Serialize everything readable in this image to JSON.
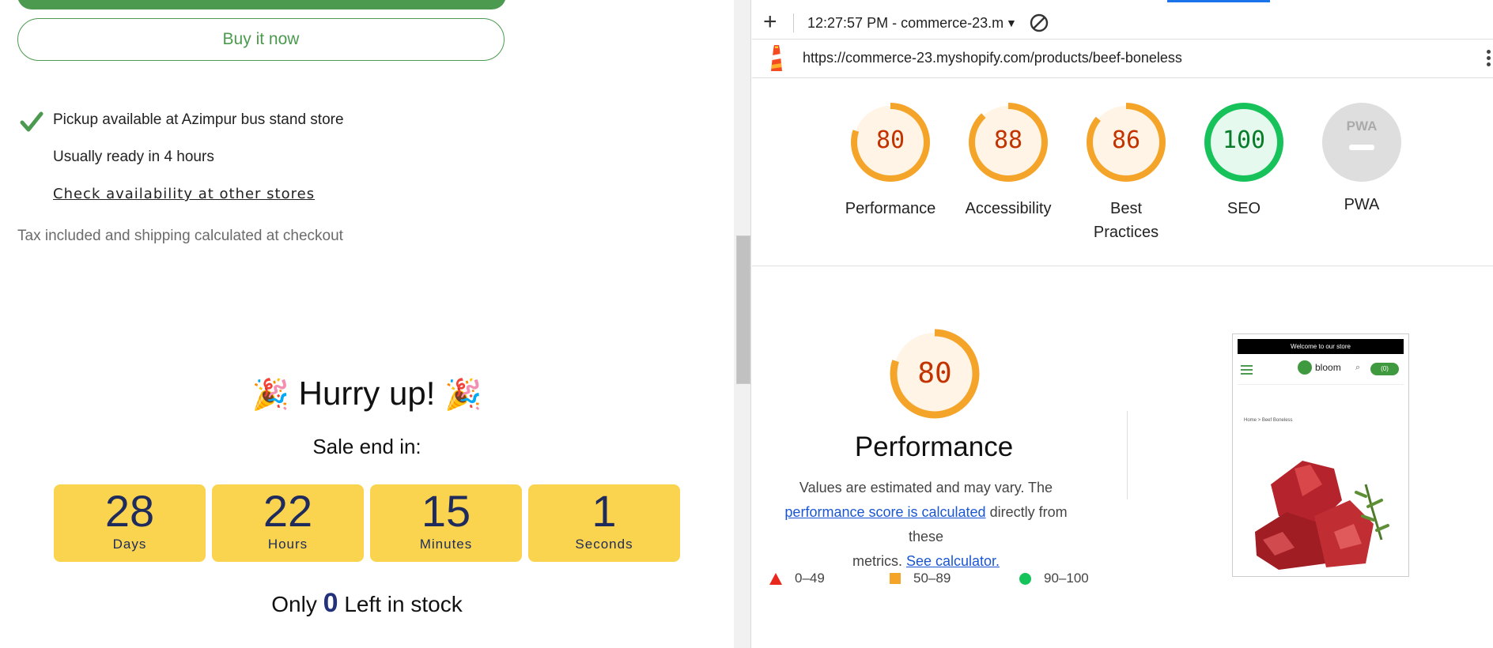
{
  "store": {
    "buy_now_label": "Buy it now",
    "pickup_text": "Pickup available at Azimpur bus stand store",
    "ready_text": "Usually ready in 4 hours",
    "check_link": "Check availability at other stores",
    "tax_text": "Tax included and shipping calculated at checkout",
    "hurry_emoji": "🎉",
    "hurry_text": "Hurry up!",
    "sale_end": "Sale end in:",
    "countdown": [
      {
        "value": "28",
        "label": "Days"
      },
      {
        "value": "22",
        "label": "Hours"
      },
      {
        "value": "15",
        "label": "Minutes"
      },
      {
        "value": "1",
        "label": "Seconds"
      }
    ],
    "stock_prefix": "Only",
    "stock_count": "0",
    "stock_suffix": "Left in stock"
  },
  "devtools": {
    "report_label": "12:27:57 PM - commerce-23.m",
    "url": "https://commerce-23.myshopify.com/products/beef-boneless",
    "categories": [
      {
        "label": "Performance",
        "score": "80",
        "value": 80,
        "color": "#f5a42a",
        "fill": "#fff4e5",
        "text_color": "#c33300"
      },
      {
        "label": "Accessibility",
        "score": "88",
        "value": 88,
        "color": "#f5a42a",
        "fill": "#fff4e5",
        "text_color": "#c33300"
      },
      {
        "label": "Best Practices",
        "score": "86",
        "value": 86,
        "color": "#f5a42a",
        "fill": "#fff4e5",
        "text_color": "#c33300"
      },
      {
        "label": "SEO",
        "score": "100",
        "value": 100,
        "color": "#18c25b",
        "fill": "#e6f9ee",
        "text_color": "#087c29"
      }
    ],
    "pwa": {
      "label": "PWA",
      "badge": "PWA"
    },
    "performance": {
      "score": "80",
      "value": 80,
      "title": "Performance",
      "desc_1": "Values are estimated and may vary. The",
      "desc_link": "performance score is calculated",
      "desc_2": "directly from these",
      "desc_3": "metrics.",
      "calc_link": "See calculator."
    },
    "legend": [
      {
        "range": "0–49",
        "color": "#e8271d"
      },
      {
        "range": "50–89",
        "color": "#f5a42a"
      },
      {
        "range": "90–100",
        "color": "#14c35a"
      }
    ],
    "thumbnail": {
      "banner": "Welcome to our store",
      "logo": "bloom",
      "cart": "(0)",
      "crumb": "Home > Beef Boneless"
    }
  }
}
